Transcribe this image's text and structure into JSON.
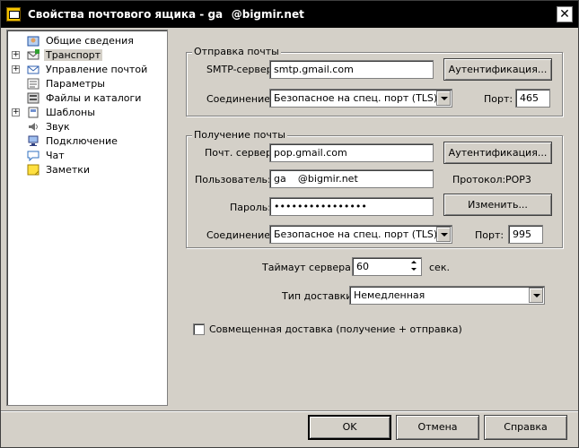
{
  "window": {
    "title": "Свойства почтового ящика - ga    @bigmir.net",
    "close": "✕"
  },
  "tree": {
    "items": [
      {
        "label": "Общие сведения",
        "expander": "",
        "icon": "user-card-icon",
        "selected": false
      },
      {
        "label": "Транспорт",
        "expander": "+",
        "icon": "transport-icon",
        "selected": true
      },
      {
        "label": "Управление почтой",
        "expander": "+",
        "icon": "mail-management-icon",
        "selected": false
      },
      {
        "label": "Параметры",
        "expander": "",
        "icon": "parameters-icon",
        "selected": false
      },
      {
        "label": "Файлы и каталоги",
        "expander": "",
        "icon": "files-icon",
        "selected": false
      },
      {
        "label": "Шаблоны",
        "expander": "+",
        "icon": "templates-icon",
        "selected": false
      },
      {
        "label": "Звук",
        "expander": "",
        "icon": "sound-icon",
        "selected": false
      },
      {
        "label": "Подключение",
        "expander": "",
        "icon": "connection-icon",
        "selected": false
      },
      {
        "label": "Чат",
        "expander": "",
        "icon": "chat-icon",
        "selected": false
      },
      {
        "label": "Заметки",
        "expander": "",
        "icon": "notes-icon",
        "selected": false
      }
    ]
  },
  "send": {
    "group_title": "Отправка почты",
    "smtp_label": "SMTP-сервер:",
    "smtp_value": "smtp.gmail.com",
    "auth_button": "Аутентификация...",
    "connection_label": "Соединение:",
    "connection_value": "Безопасное на спец. порт (TLS)",
    "port_label": "Порт:",
    "port_value": "465"
  },
  "receive": {
    "group_title": "Получение почты",
    "server_label": "Почт. сервер:",
    "server_value": "pop.gmail.com",
    "auth_button": "Аутентификация...",
    "user_label": "Пользователь:",
    "user_value": "ga      @bigmir.net",
    "protocol_label": "Протокол:",
    "protocol_value": "POP3",
    "password_label": "Пароль:",
    "password_value": "••••••••••••••••",
    "change_button": "Изменить...",
    "connection_label": "Соединение:",
    "connection_value": "Безопасное на спец. порт (TLS)",
    "port_label": "Порт:",
    "port_value": "995"
  },
  "timeout": {
    "label": "Таймаут сервера:",
    "value": "60",
    "unit": "сек."
  },
  "delivery": {
    "label": "Тип доставки:",
    "value": "Немедленная"
  },
  "combined": {
    "label": "Совмещенная доставка (получение + отправка)",
    "checked": false
  },
  "buttons": {
    "ok": "OK",
    "cancel": "Отмена",
    "help": "Справка"
  }
}
